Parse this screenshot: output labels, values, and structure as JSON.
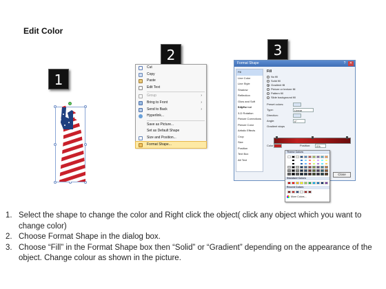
{
  "title": "Edit Color",
  "step_numbers": [
    "1",
    "2",
    "3"
  ],
  "context_menu": {
    "items": [
      {
        "label": "Cut",
        "state": "normal"
      },
      {
        "label": "Copy",
        "state": "normal"
      },
      {
        "label": "Paste",
        "state": "normal"
      },
      {
        "label": "Edit Text",
        "state": "normal"
      },
      {
        "label": "Group",
        "state": "dim",
        "submenu": true
      },
      {
        "label": "Bring to Front",
        "state": "normal",
        "submenu": true
      },
      {
        "label": "Send to Back",
        "state": "normal",
        "submenu": true
      },
      {
        "label": "Hyperlink...",
        "state": "normal"
      },
      {
        "label": "Save as Picture...",
        "state": "normal"
      },
      {
        "label": "Set as Default Shape",
        "state": "normal"
      },
      {
        "label": "Size and Position...",
        "state": "normal"
      },
      {
        "label": "Format Shape...",
        "state": "highlighted"
      }
    ]
  },
  "format_dialog": {
    "title": "Format Shape",
    "help": "?",
    "close_glyph": "✕",
    "nav": [
      "Fill",
      "Line Color",
      "Line Style",
      "Shadow",
      "Reflection",
      "Glow and Soft Edges",
      "3-D Format",
      "3-D Rotation",
      "Picture Corrections",
      "Picture Color",
      "Artistic Effects",
      "Crop",
      "Size",
      "Position",
      "Text Box",
      "Alt Text"
    ],
    "heading": "Fill",
    "fill_options": [
      "No fill",
      "Solid fill",
      "Gradient fill",
      "Picture or texture fill",
      "Pattern fill",
      "Slide background fill"
    ],
    "selected_fill": "Gradient fill",
    "fields": [
      {
        "label": "Preset colors:",
        "value": ""
      },
      {
        "label": "Type:",
        "value": "Linear"
      },
      {
        "label": "Direction:",
        "value": ""
      },
      {
        "label": "Angle:",
        "value": "0°"
      },
      {
        "label": "Gradient stops",
        "value": ""
      }
    ],
    "color_label": "Color",
    "position_label": "Position:",
    "position_value": "0%",
    "brightness_label": "Brightness",
    "transparency_label": "Transparen",
    "rotate_label": "Rotate",
    "close_label": "Close"
  },
  "palette": {
    "theme_label": "Theme Colors",
    "standard_label": "Standard Colors",
    "recent_label": "Recent Colors",
    "more_label": "More Colors...",
    "theme_colors": [
      "#ffffff",
      "#000000",
      "#eeece1",
      "#1f497d",
      "#4f81bd",
      "#c0504d",
      "#9bbb59",
      "#8064a2",
      "#4bacc6",
      "#f79646"
    ],
    "standard_colors": [
      "#c00000",
      "#ff0000",
      "#ffc000",
      "#ffff00",
      "#92d050",
      "#00b050",
      "#00b0f0",
      "#0070c0",
      "#002060",
      "#7030a0"
    ],
    "recent_colors": [
      "#7a1010",
      "#c02020",
      "#1f3f7f",
      "#ffffff",
      "#a01515",
      "#6a0d0d"
    ]
  },
  "instructions": [
    {
      "num": "1.",
      "text": "Select the shape to change the color and Right click the object( click any object which you want to change color)"
    },
    {
      "num": "2.",
      "text": "Choose Format Shape in the dialog box."
    },
    {
      "num": "3.",
      "text": "Choose “Fill” in the Format Shape box then “Solid” or “Gradient” depending on the appearance of the object. Change colour as shown in the picture."
    }
  ]
}
